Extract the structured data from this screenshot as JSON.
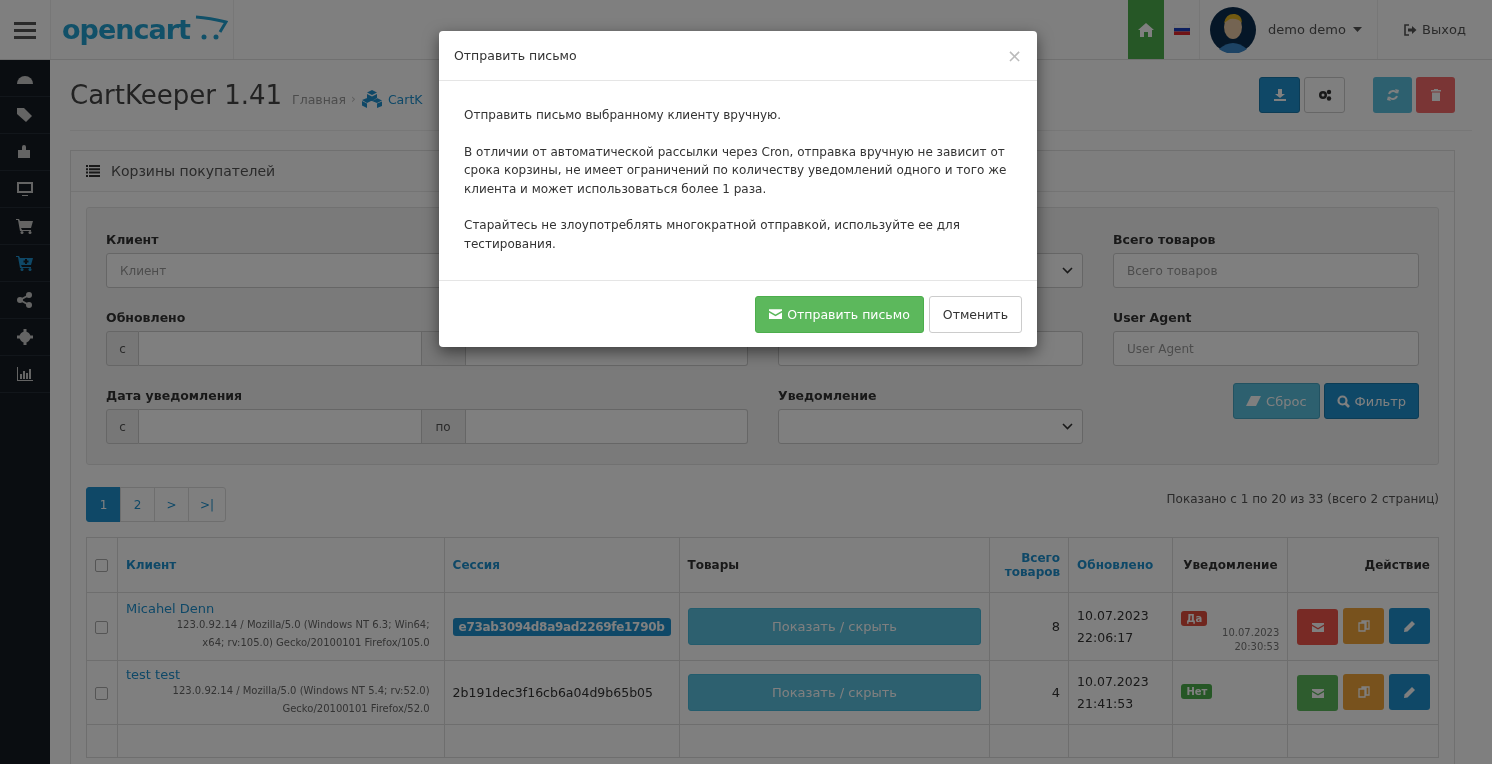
{
  "header": {
    "logo": "opencart",
    "user": "demo demo",
    "logout": "Выход"
  },
  "sidebar": {
    "items": [
      {
        "selected": false
      },
      {
        "selected": false
      },
      {
        "selected": false
      },
      {
        "selected": false
      },
      {
        "selected": false
      },
      {
        "selected": true
      },
      {
        "selected": false
      },
      {
        "selected": false
      },
      {
        "selected": false
      }
    ]
  },
  "page": {
    "title": "CartKeeper 1.41",
    "breadcrumb": [
      "Главная",
      "CartK"
    ],
    "separator": "›"
  },
  "panel": {
    "title": "Корзины покупателей"
  },
  "filters": [
    {
      "kind": "text",
      "label": "Клиент",
      "placeholder": "Клиент"
    },
    {
      "kind": "select"
    },
    {
      "kind": "text",
      "label": "Всего товаров",
      "placeholder": "Всего товаров"
    },
    {
      "kind": "range",
      "label": "Обновлено",
      "from": "с"
    },
    {
      "kind": "text"
    },
    {
      "kind": "text",
      "label": "User Agent",
      "placeholder": "User Agent"
    },
    {
      "kind": "range",
      "label": "Дата уведомления",
      "from": "с",
      "to": "по"
    },
    {
      "kind": "select",
      "label": "Уведомление"
    },
    {
      "kind": "buttons",
      "reset": "Сброс",
      "filter": "Фильтр"
    }
  ],
  "pagination": {
    "pages": [
      {
        "label": "1",
        "selected": true
      },
      {
        "label": "2",
        "selected": false
      },
      {
        "label": ">",
        "selected": false
      },
      {
        "label": ">|",
        "selected": false
      }
    ],
    "summary": "Показано с 1 по 20 из 33 (всего 2 страниц)"
  },
  "table": {
    "all_checked": false,
    "columns": [
      {
        "label": "Клиент",
        "sortable": true
      },
      {
        "label": "Сессия",
        "sortable": true
      },
      {
        "label": "Товары",
        "sortable": false
      },
      {
        "label": "Всего товаров",
        "sortable": true
      },
      {
        "label": "Обновлено",
        "sortable": true
      },
      {
        "label": "Уведомление",
        "sortable": false
      },
      {
        "label": "Действие",
        "sortable": false
      }
    ],
    "rows": [
      {
        "checked": false,
        "client": "Micahel Denn",
        "agent": "123.0.92.14 / Mozilla/5.0 (Windows NT 6.3; Win64; x64; rv:105.0) Gecko/20100101 Firefox/105.0",
        "session": "e73ab3094d8a9ad2269fe1790b",
        "session_highlighted": true,
        "products": "Показать / скрыть",
        "total": "8",
        "updated": "10.07.2023 22:06:17",
        "notified": true,
        "badge": "Да",
        "notified_at": "10.07.2023 20:30:53"
      },
      {
        "checked": false,
        "client": "test test",
        "agent": "123.0.92.14 / Mozilla/5.0 (Windows NT 5.4; rv:52.0) Gecko/20100101 Firefox/52.0",
        "session": "2b191dec3f16cb6a04d9b65b05",
        "session_highlighted": false,
        "products": "Показать / скрыть",
        "total": "4",
        "updated": "10.07.2023 21:41:53",
        "notified": false,
        "badge": "Нет"
      }
    ]
  },
  "modal": {
    "title": "Отправить письмо",
    "close": "×",
    "paragraphs": [
      "Отправить письмо выбранному клиенту вручную.",
      "В отличии от автоматической рассылки через Cron, отправка вручную не зависит от срока корзины, не имеет ограничений по количеству уведомлений одного и того же клиента и может использоваться более 1 раза.",
      "Старайтесь не злоупотреблять многократной отправкой, используйте ее для тестирования."
    ],
    "send": "Отправить письмо",
    "cancel": "Отменить"
  }
}
